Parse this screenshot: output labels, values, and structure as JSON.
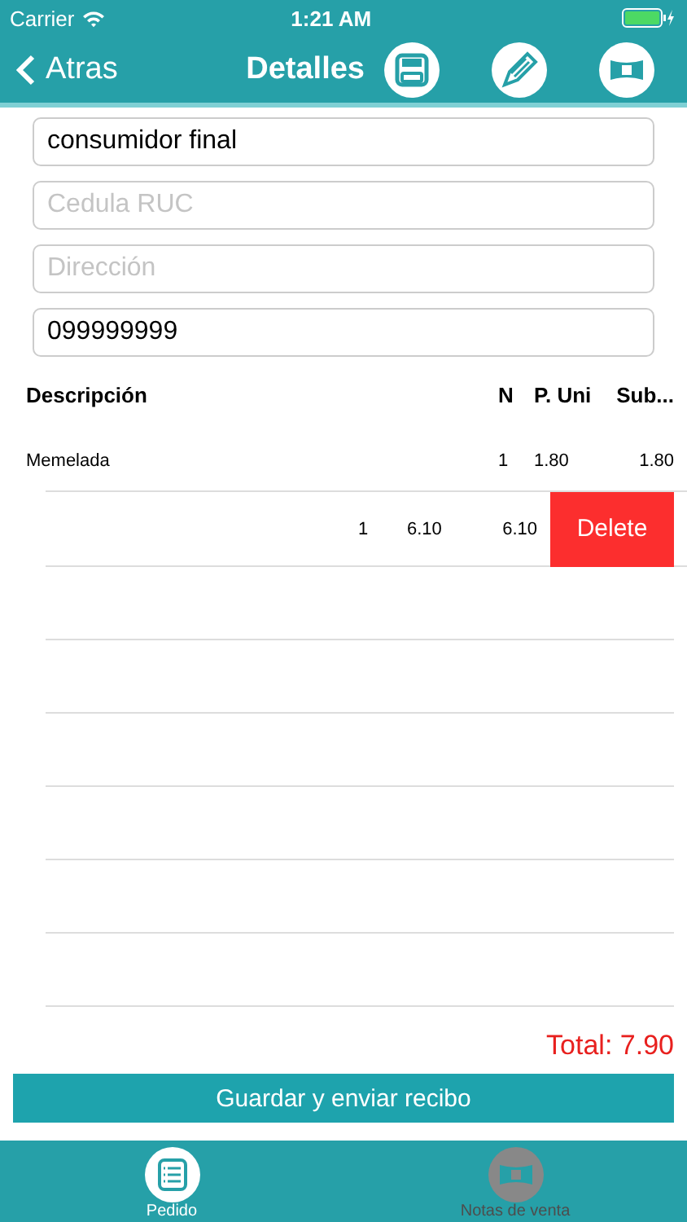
{
  "status_bar": {
    "carrier": "Carrier",
    "time": "1:21 AM"
  },
  "nav": {
    "back": "Atras",
    "title": "Detalles"
  },
  "fields": [
    {
      "value": "consumidor final"
    },
    {
      "placeholder": "Cedula RUC"
    },
    {
      "placeholder": "Dirección"
    },
    {
      "value": "099999999"
    }
  ],
  "table": {
    "columns": [
      "Descripción",
      "N",
      "P. Uni",
      "Sub..."
    ],
    "rows": [
      {
        "swiped": false,
        "description": "Memelada",
        "n": "1",
        "price": "1.80",
        "subtotal": "1.80"
      },
      {
        "swiped": true,
        "n": "1",
        "price": "6.10",
        "subtotal": "6.10",
        "action": "Delete"
      }
    ]
  },
  "total": "Total: 7.90",
  "save_button": "Guardar y enviar recibo",
  "tabs": [
    {
      "label": "Pedido",
      "selected": true,
      "kind": "list"
    },
    {
      "label": "Notas de venta",
      "selected": false,
      "kind": "bill"
    }
  ]
}
